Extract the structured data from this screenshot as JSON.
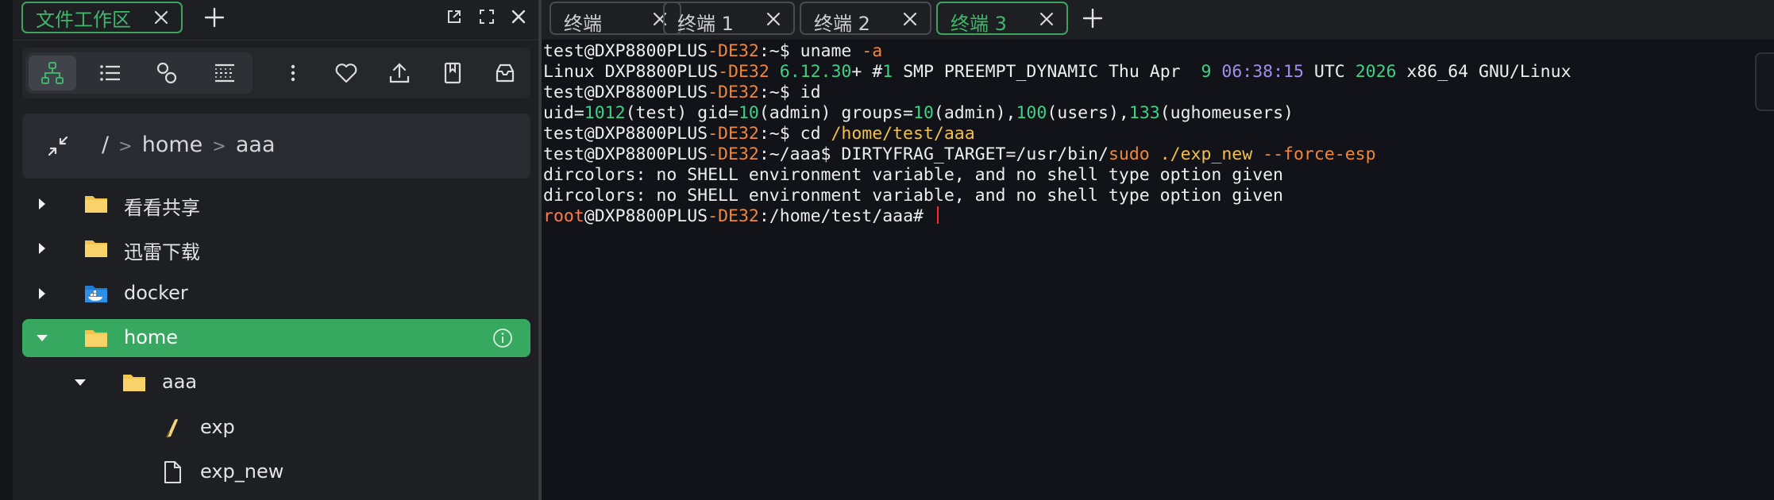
{
  "workspace": {
    "tab_label": "文件工作区",
    "path": [
      "/",
      "home",
      "aaa"
    ],
    "tree": [
      {
        "name": "看看共享",
        "depth": 0,
        "caret": "right",
        "icon": "folder-icon",
        "active": false
      },
      {
        "name": "迅雷下载",
        "depth": 0,
        "caret": "right",
        "icon": "folder-icon",
        "active": false
      },
      {
        "name": "docker",
        "depth": 0,
        "caret": "right",
        "icon": "docker-folder-icon",
        "active": false
      },
      {
        "name": "home",
        "depth": 0,
        "caret": "down",
        "icon": "folder-icon",
        "active": true
      },
      {
        "name": "aaa",
        "depth": 1,
        "caret": "down",
        "icon": "folder-icon",
        "active": false
      },
      {
        "name": "exp",
        "depth": 2,
        "caret": "none",
        "icon": "feather-file-icon",
        "active": false
      },
      {
        "name": "exp_new",
        "depth": 2,
        "caret": "none",
        "icon": "file-icon",
        "active": false
      }
    ]
  },
  "terminal": {
    "tabs": [
      {
        "label": "终端",
        "active": false
      },
      {
        "label": "终端 1",
        "active": false
      },
      {
        "label": "终端 2",
        "active": false
      },
      {
        "label": "终端 3",
        "active": true
      }
    ],
    "lines": [
      [
        [
          "test@DXP8800PLUS",
          "w"
        ],
        [
          "-DE32",
          "or"
        ],
        [
          ":~$ uname ",
          "w"
        ],
        [
          "-a",
          "or"
        ]
      ],
      [
        [
          "Linux DXP8800PLUS",
          "w"
        ],
        [
          "-DE32",
          "or"
        ],
        [
          " ",
          "w"
        ],
        [
          "6.12.30",
          "gr"
        ],
        [
          "+ #",
          "w"
        ],
        [
          "1",
          "gr"
        ],
        [
          " SMP PREEMPT_DYNAMIC Thu Apr  ",
          "w"
        ],
        [
          "9",
          "gr"
        ],
        [
          " ",
          "w"
        ],
        [
          "06:38:15",
          "pu"
        ],
        [
          " UTC ",
          "w"
        ],
        [
          "2026",
          "gr"
        ],
        [
          " x86_64 GNU/Linux",
          "w"
        ]
      ],
      [
        [
          "test@DXP8800PLUS",
          "w"
        ],
        [
          "-DE32",
          "or"
        ],
        [
          ":~$ id",
          "w"
        ]
      ],
      [
        [
          "uid=",
          "w"
        ],
        [
          "1012",
          "gr"
        ],
        [
          "(test) gid=",
          "w"
        ],
        [
          "10",
          "gr"
        ],
        [
          "(admin) groups=",
          "w"
        ],
        [
          "10",
          "gr"
        ],
        [
          "(admin),",
          "w"
        ],
        [
          "100",
          "gr"
        ],
        [
          "(users),",
          "w"
        ],
        [
          "133",
          "gr"
        ],
        [
          "(ughomeusers)",
          "w"
        ]
      ],
      [
        [
          "test@DXP8800PLUS",
          "w"
        ],
        [
          "-DE32",
          "or"
        ],
        [
          ":~$ cd ",
          "w"
        ],
        [
          "/home/test/aaa",
          "yl"
        ]
      ],
      [
        [
          "test@DXP8800PLUS",
          "w"
        ],
        [
          "-DE32",
          "or"
        ],
        [
          ":~/aaa$ DIRTYFRAG_TARGET=/usr/bin/",
          "w"
        ],
        [
          "sudo",
          "or"
        ],
        [
          " ",
          "w"
        ],
        [
          "./exp_new",
          "yl"
        ],
        [
          " ",
          "w"
        ],
        [
          "--force-esp",
          "or"
        ]
      ],
      [
        [
          "dircolors: no SHELL environment variable, and no shell type option given",
          "w"
        ]
      ],
      [
        [
          "dircolors: no SHELL environment variable, and no shell type option given",
          "w"
        ]
      ],
      [
        [
          "root",
          "rd"
        ],
        [
          "@DXP8800PLUS",
          "w"
        ],
        [
          "-DE32",
          "or"
        ],
        [
          ":/home/test/aaa# ",
          "w"
        ]
      ]
    ]
  },
  "colors": {
    "accent_green": "#3fa35e",
    "active_row": "#36a85f",
    "terminal_bg": "#111318",
    "cursor": "#ff2a2a"
  }
}
